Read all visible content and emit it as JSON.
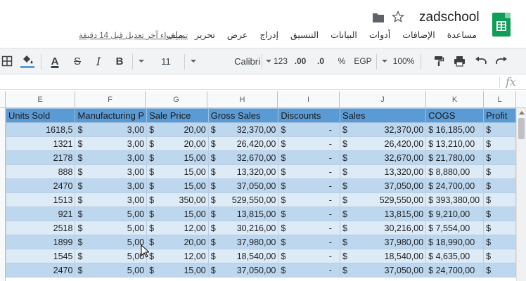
{
  "app": {
    "title": "zadschool",
    "last_edit": "تم إجراء آخر تعديل قبل 14 دقيقة",
    "menu": [
      "ملف",
      "تحرير",
      "عرض",
      "إدراج",
      "التنسيق",
      "البيانات",
      "أدوات",
      "الإضافات",
      "مساعدة"
    ]
  },
  "toolbar": {
    "zoom": "100%",
    "currency": "EGP",
    "percent": "%",
    "decimal_decrease": ".0",
    "decimal_increase": ".00",
    "number_format": "123",
    "font": "Calibri",
    "font_size": "11",
    "bold": "B",
    "italic": "I",
    "strike": "S",
    "text_color": "A"
  },
  "formula_bar": {
    "fx": "fx",
    "value": ""
  },
  "columns": [
    "E",
    "F",
    "G",
    "H",
    "I",
    "J",
    "K",
    "L"
  ],
  "table": {
    "headers": [
      "Units Sold",
      "Manufacturing P",
      "Sale Price",
      "Gross Sales",
      "Discounts",
      "Sales",
      "COGS",
      "Profit"
    ],
    "currency_symbol": "$",
    "rows": [
      [
        "1618,5",
        "3,00",
        "20,00",
        "32,370,00",
        "-",
        "32,370,00",
        "16,185,00",
        ""
      ],
      [
        "1321",
        "3,00",
        "20,00",
        "26,420,00",
        "-",
        "26,420,00",
        "13,210,00",
        ""
      ],
      [
        "2178",
        "3,00",
        "15,00",
        "32,670,00",
        "-",
        "32,670,00",
        "21,780,00",
        ""
      ],
      [
        "888",
        "3,00",
        "15,00",
        "13,320,00",
        "-",
        "13,320,00",
        "8,880,00",
        ""
      ],
      [
        "2470",
        "3,00",
        "15,00",
        "37,050,00",
        "-",
        "37,050,00",
        "24,700,00",
        ""
      ],
      [
        "1513",
        "3,00",
        "350,00",
        "529,550,00",
        "-",
        "529,550,00",
        "393,380,00",
        ""
      ],
      [
        "921",
        "5,00",
        "15,00",
        "13,815,00",
        "-",
        "13,815,00",
        "9,210,00",
        ""
      ],
      [
        "2518",
        "5,00",
        "12,00",
        "30,216,00",
        "-",
        "30,216,00",
        "7,554,00",
        ""
      ],
      [
        "1899",
        "5,00",
        "20,00",
        "37,980,00",
        "-",
        "37,980,00",
        "18,990,00",
        ""
      ],
      [
        "1545",
        "5,00",
        "12,00",
        "18,540,00",
        "-",
        "18,540,00",
        "4,635,00",
        ""
      ],
      [
        "2470",
        "5,00",
        "15,00",
        "37,050,00",
        "-",
        "37,050,00",
        "24,700,00",
        ""
      ]
    ]
  },
  "colors": {
    "header_bg": "#5b9bd5",
    "row_odd": "#bdd7ee",
    "row_even": "#ddebf7",
    "logo": "#0f9d58"
  }
}
